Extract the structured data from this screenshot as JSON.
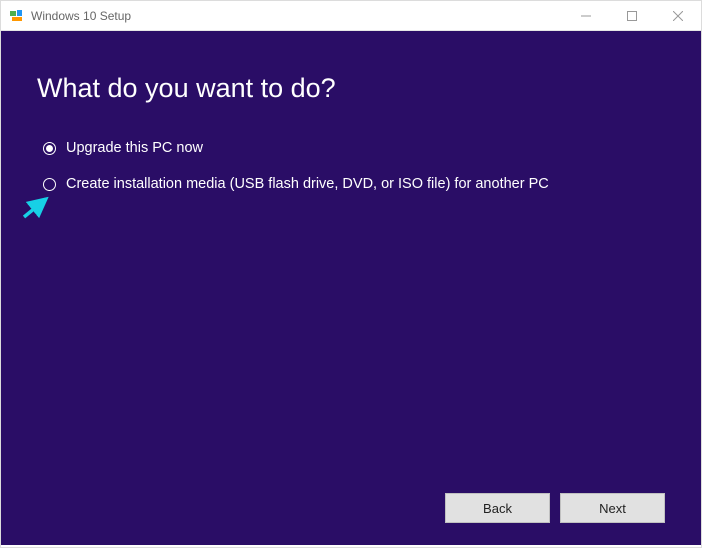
{
  "titlebar": {
    "title": "Windows 10 Setup"
  },
  "main": {
    "heading": "What do you want to do?",
    "options": [
      {
        "label": "Upgrade this PC now",
        "selected": true
      },
      {
        "label": "Create installation media (USB flash drive, DVD, or ISO file) for another PC",
        "selected": false
      }
    ]
  },
  "buttons": {
    "back": "Back",
    "next": "Next"
  }
}
